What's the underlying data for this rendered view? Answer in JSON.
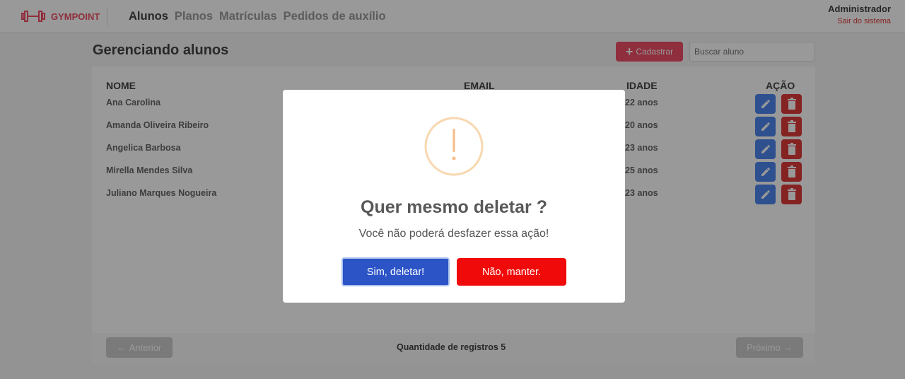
{
  "app": {
    "brand": "GYMPOINT"
  },
  "nav": {
    "items": [
      "Alunos",
      "Planos",
      "Matrículas",
      "Pedidos de auxílio"
    ],
    "active": 0
  },
  "user": {
    "name": "Administrador",
    "logout": "Sair do sistema"
  },
  "page": {
    "title": "Gerenciando alunos",
    "add_label": "Cadastrar",
    "search_placeholder": "Buscar aluno"
  },
  "table": {
    "headers": {
      "name": "NOME",
      "email": "EMAIL",
      "age": "IDADE",
      "action": "AÇÃO"
    },
    "rows": [
      {
        "name": "Ana Carolina",
        "age": "22 anos"
      },
      {
        "name": "Amanda Oliveira Ribeiro",
        "age": "20 anos"
      },
      {
        "name": "Angelica Barbosa",
        "age": "23 anos"
      },
      {
        "name": "Mirella Mendes Silva",
        "age": "25 anos"
      },
      {
        "name": "Juliano Marques Nogueira",
        "age": "23 anos"
      }
    ]
  },
  "pagination": {
    "prev": "Anterior",
    "records": "Quantidade de registros 5",
    "next": "Próximo"
  },
  "modal": {
    "icon": "warning-icon",
    "title": "Quer mesmo deletar ?",
    "text": "Você não poderá desfazer essa ação!",
    "confirm": "Sim, deletar!",
    "cancel": "Não, manter."
  },
  "colors": {
    "brand": "#ee4d64",
    "edit": "#4d85ee",
    "delete": "#de3b3b",
    "confirm": "#2c54c7",
    "cancel": "#f00a0a",
    "warning": "#f8bb86"
  }
}
